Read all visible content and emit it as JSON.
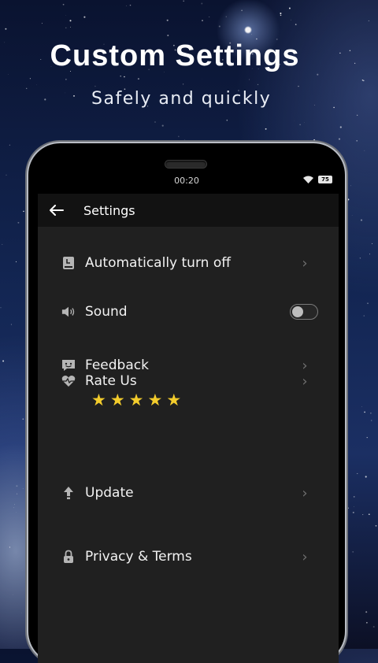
{
  "promo": {
    "title": "Custom Settings",
    "subtitle": "Safely and quickly"
  },
  "status_bar": {
    "time": "00:20",
    "battery": "75"
  },
  "appbar": {
    "title": "Settings"
  },
  "settings": {
    "items": [
      {
        "label": "Automatically turn off",
        "icon": "timer-icon",
        "control": "chevron"
      },
      {
        "label": "Sound",
        "icon": "speaker-icon",
        "control": "toggle",
        "enabled": false
      },
      {
        "label": "Feedback",
        "icon": "feedback-icon",
        "control": "chevron"
      },
      {
        "label": "Rate Us",
        "icon": "heart-pulse-icon",
        "control": "chevron",
        "rating": 5
      },
      {
        "label": "Update",
        "icon": "upload-arrow-icon",
        "control": "chevron"
      },
      {
        "label": "Privacy & Terms",
        "icon": "lock-icon",
        "control": "chevron"
      }
    ]
  },
  "colors": {
    "screen_background": "#202020",
    "appbar_background": "#121212",
    "star_color": "#f3cc2c",
    "icon_color": "#b5b5b5",
    "chevron_color": "#6e6e6e"
  }
}
